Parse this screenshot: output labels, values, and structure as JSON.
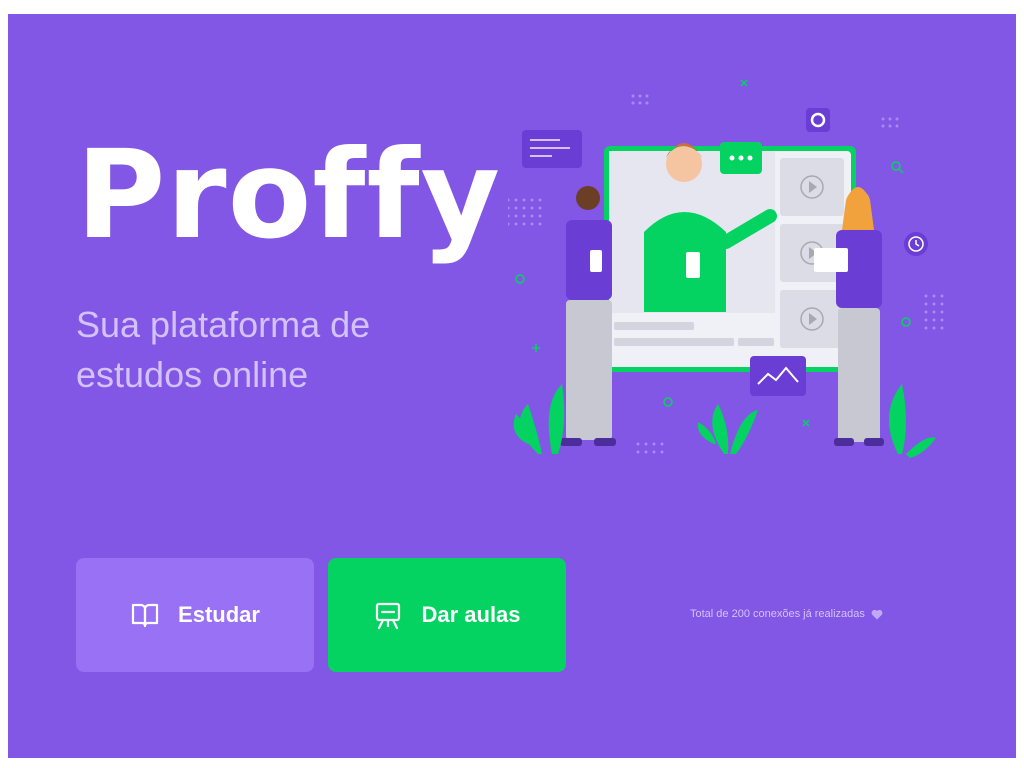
{
  "brand": {
    "name": "Proffy"
  },
  "hero": {
    "tagline_line1": "Sua plataforma de",
    "tagline_line2": "estudos online"
  },
  "buttons": {
    "study": {
      "label": "Estudar",
      "icon": "book-open-icon"
    },
    "teach": {
      "label": "Dar aulas",
      "icon": "presentation-board-icon"
    }
  },
  "footer": {
    "connections_text": "Total de 200 conexões já realizadas",
    "icon": "purple-heart-icon"
  },
  "colors": {
    "background": "#8257E5",
    "primary_light": "#9871F5",
    "secondary": "#04D361",
    "text_light": "#D4C2FF"
  }
}
